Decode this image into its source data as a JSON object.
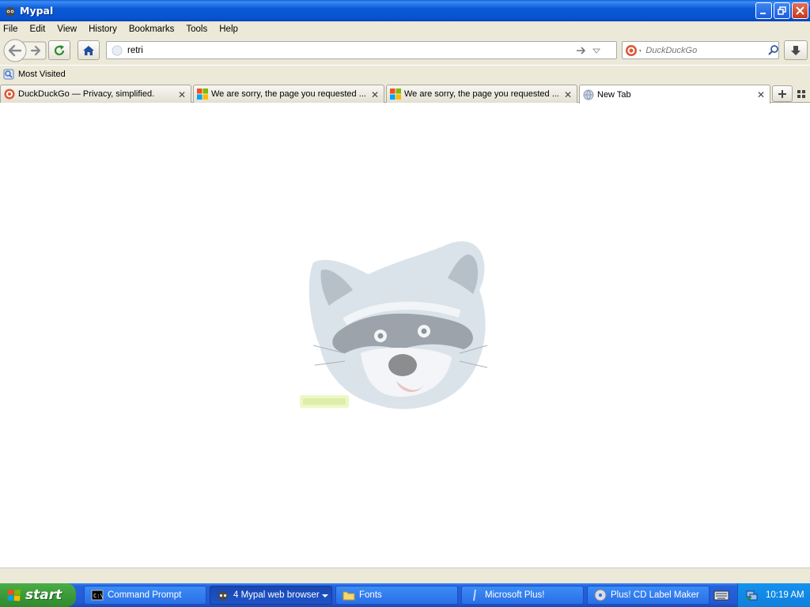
{
  "window": {
    "title": "Mypal"
  },
  "menu": [
    {
      "label": "File"
    },
    {
      "label": "Edit"
    },
    {
      "label": "View"
    },
    {
      "label": "History"
    },
    {
      "label": "Bookmarks"
    },
    {
      "label": "Tools"
    },
    {
      "label": "Help"
    }
  ],
  "navbar": {
    "url": "retri",
    "search_placeholder": "DuckDuckGo"
  },
  "bookmarks": {
    "most_visited": "Most Visited"
  },
  "tabs": [
    {
      "label": "DuckDuckGo — Privacy, simplified."
    },
    {
      "label": "We are sorry, the page you requested ..."
    },
    {
      "label": "We are sorry, the page you requested ..."
    },
    {
      "label": "New Tab"
    }
  ],
  "taskbar": {
    "start": "start",
    "items": [
      {
        "label": "Command Prompt"
      },
      {
        "label": "4 Mypal web browser"
      },
      {
        "label": "Fonts"
      },
      {
        "label": "Microsoft Plus!"
      },
      {
        "label": "Plus! CD Label Maker"
      }
    ],
    "clock": "10:19 AM"
  }
}
